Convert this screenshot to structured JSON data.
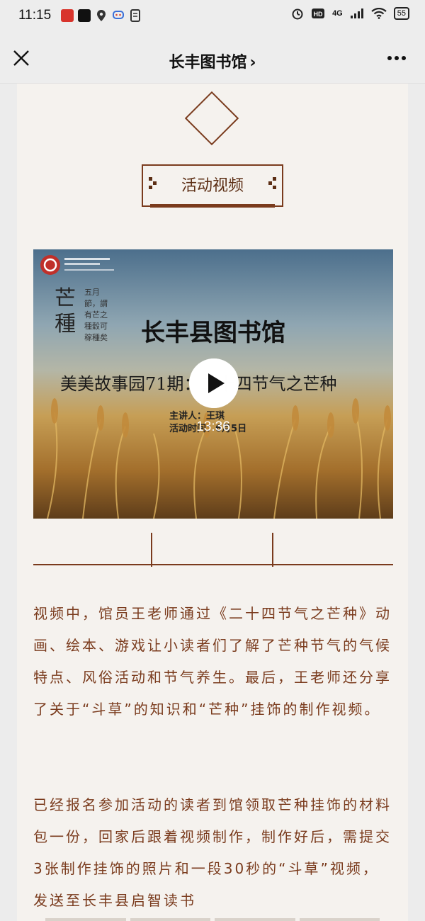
{
  "status_bar": {
    "time": "11:15",
    "battery": "55",
    "network": "4G"
  },
  "title_bar": {
    "title": "长丰图书馆",
    "chevron": "›",
    "close_icon": "close-icon",
    "more_icon": "more-icon"
  },
  "section": {
    "title": "活动视频"
  },
  "video": {
    "headline": "长丰县图书馆",
    "subtitle": "美美故事园71期：二十四节气之芒种",
    "speaker": "主讲人：王琪",
    "date": "活动时间：6月5日",
    "calligraphy": "芒種",
    "poem": "五月節，謂有芒之種穀可稼種矣",
    "duration": "13:36"
  },
  "paragraphs": [
    "视频中，馆员王老师通过《二十四节气之芒种》动画、绘本、游戏让小读者们了解了芒种节气的气候特点、风俗活动和节气养生。最后，王老师还分享了关于“斗草”的知识和“芒种”挂饰的制作视频。",
    "已经报名参加活动的读者到馆领取芒种挂饰的材料包一份，回家后跟着视频制作，制作好后，需提交3张制作挂饰的照片和一段30秒的“斗草”视频，发送至长丰县启智读书"
  ],
  "colors": {
    "accent": "#7a3b1d",
    "background": "#f5f2ee"
  }
}
